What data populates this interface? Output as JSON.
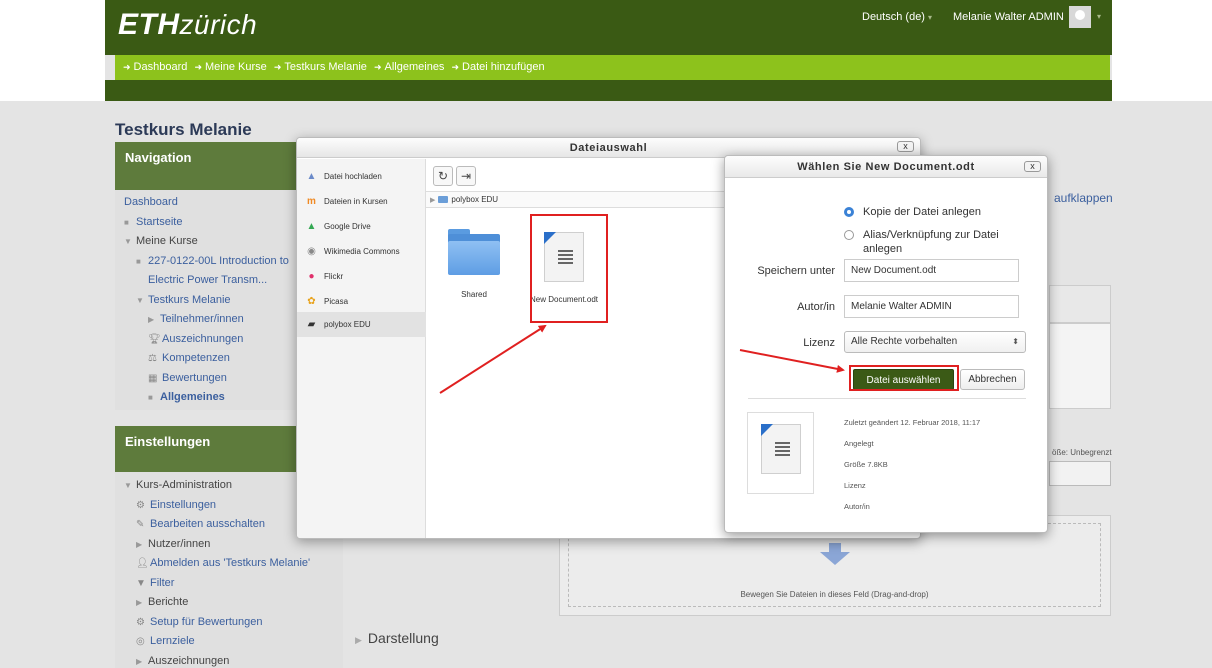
{
  "header": {
    "brand_bold": "ETH",
    "brand_rest": "zürich",
    "language": "Deutsch (de)",
    "user_name": "Melanie Walter ADMIN",
    "caret": "▾"
  },
  "breadcrumb": [
    "Dashboard",
    "Meine Kurse",
    "Testkurs Melanie",
    "Allgemeines",
    "Datei hinzufügen"
  ],
  "course_title": "Testkurs Melanie",
  "navigation": {
    "title": "Navigation",
    "items": [
      {
        "label": "Dashboard"
      },
      {
        "label": "Startseite"
      },
      {
        "label": "Meine Kurse"
      },
      {
        "label": "227-0122-00L Introduction to"
      },
      {
        "label": "Electric Power Transm..."
      },
      {
        "label": "Testkurs Melanie"
      },
      {
        "label": "Teilnehmer/innen"
      },
      {
        "label": "Auszeichnungen"
      },
      {
        "label": "Kompetenzen"
      },
      {
        "label": "Bewertungen"
      },
      {
        "label": "Allgemeines"
      }
    ]
  },
  "settings": {
    "title": "Einstellungen",
    "items": [
      {
        "label": "Kurs-Administration"
      },
      {
        "label": "Einstellungen"
      },
      {
        "label": "Bearbeiten ausschalten"
      },
      {
        "label": "Nutzer/innen"
      },
      {
        "label": "Abmelden aus 'Testkurs Melanie'"
      },
      {
        "label": "Filter"
      },
      {
        "label": "Berichte"
      },
      {
        "label": "Setup für Bewertungen"
      },
      {
        "label": "Lernziele"
      },
      {
        "label": "Auszeichnungen"
      }
    ]
  },
  "main": {
    "expand_link": "aufklappen",
    "max_size": "öße: Unbegrenzt",
    "drop_hint": "Bewegen Sie Dateien in dieses Feld (Drag-and-drop)",
    "section_darstellung": "Darstellung"
  },
  "file_picker": {
    "title": "Dateiauswahl",
    "close": "x",
    "repositories": [
      {
        "label": "Datei hochladen",
        "icon": "upload-icon"
      },
      {
        "label": "Dateien in Kursen",
        "icon": "moodle-icon"
      },
      {
        "label": "Google Drive",
        "icon": "google-drive-icon"
      },
      {
        "label": "Wikimedia Commons",
        "icon": "wikimedia-icon"
      },
      {
        "label": "Flickr",
        "icon": "flickr-icon"
      },
      {
        "label": "Picasa",
        "icon": "picasa-icon"
      },
      {
        "label": "polybox EDU",
        "icon": "polybox-icon"
      }
    ],
    "path": "polybox EDU",
    "files": [
      {
        "label": "Shared",
        "type": "folder"
      },
      {
        "label": "New Document.odt",
        "type": "document"
      }
    ]
  },
  "select_dialog": {
    "title": "Wählen Sie New Document.odt",
    "close": "x",
    "option_copy": "Kopie der Datei anlegen",
    "option_alias_line1": "Alias/Verknüpfung zur Datei",
    "option_alias_line2": "anlegen",
    "save_as_label": "Speichern unter",
    "save_as_value": "New Document.odt",
    "author_label": "Autor/in",
    "author_value": "Melanie Walter ADMIN",
    "license_label": "Lizenz",
    "license_value": "Alle Rechte vorbehalten",
    "select_button": "Datei auswählen",
    "cancel_button": "Abbrechen",
    "meta_modified": "Zuletzt geändert  12. Februar 2018, 11:17",
    "meta_created": "Angelegt",
    "meta_size": "Größe  7.8KB",
    "meta_license": "Lizenz",
    "meta_author": "Autor/in"
  },
  "colors": {
    "header_green": "#3a5a14",
    "breadcrumb_green": "#8dc21c",
    "block_header": "#5e7b3c",
    "link_blue": "#3b5f9e",
    "annotation_red": "#e02020"
  }
}
